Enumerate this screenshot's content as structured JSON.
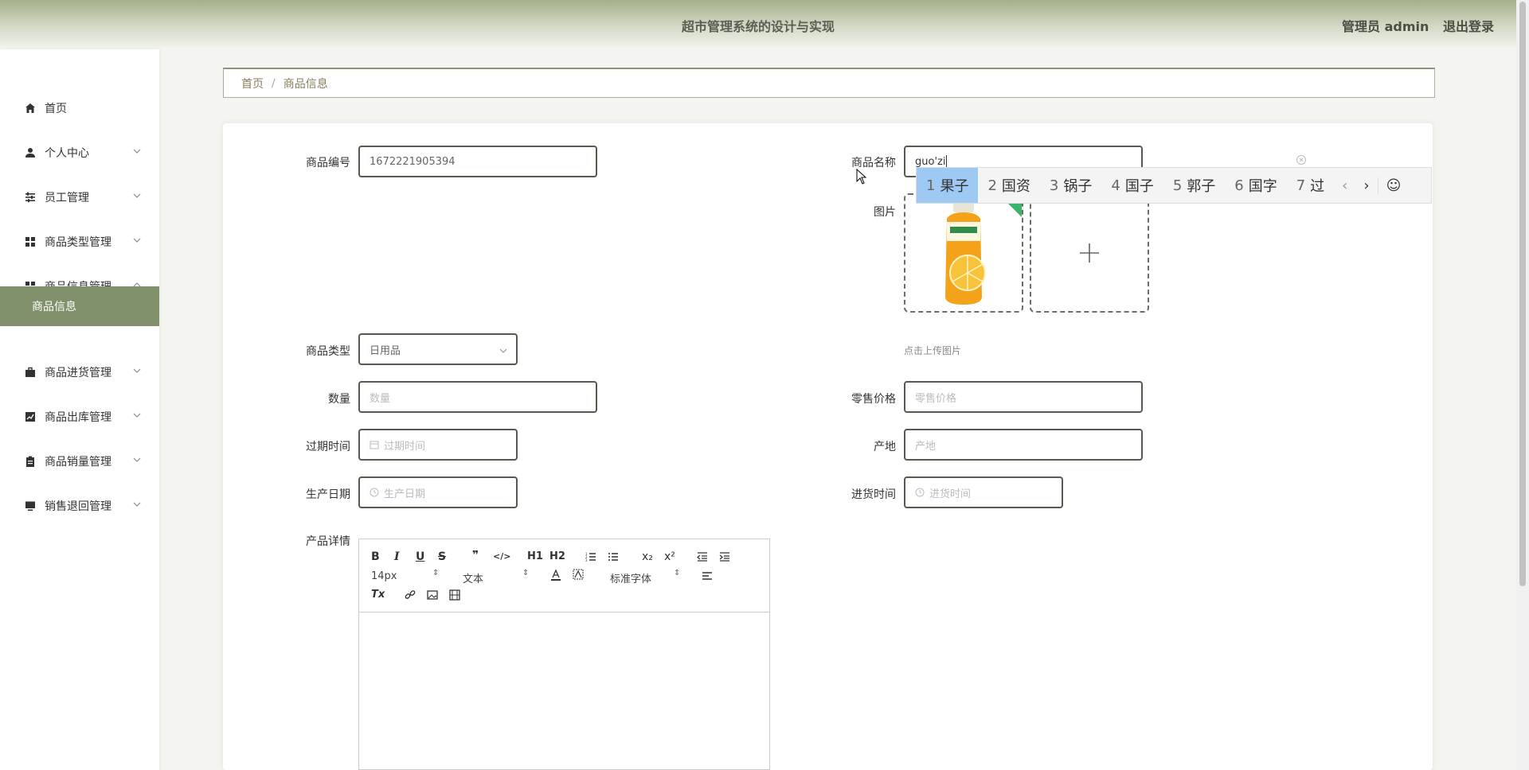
{
  "header": {
    "title": "超市管理系统的设计与实现",
    "role": "管理员 admin",
    "logout": "退出登录"
  },
  "sidebar": {
    "items": [
      {
        "label": "首页",
        "icon": "home-icon"
      },
      {
        "label": "个人中心",
        "icon": "user-icon"
      },
      {
        "label": "员工管理",
        "icon": "sliders-icon"
      },
      {
        "label": "商品类型管理",
        "icon": "grid-icon"
      },
      {
        "label": "商品信息管理",
        "icon": "grid-icon"
      },
      {
        "label": "商品进货管理",
        "icon": "briefcase-icon"
      },
      {
        "label": "商品出库管理",
        "icon": "chart-icon"
      },
      {
        "label": "商品销量管理",
        "icon": "clipboard-icon"
      },
      {
        "label": "销售退回管理",
        "icon": "monitor-icon"
      }
    ],
    "active_sub": "商品信息"
  },
  "breadcrumb": {
    "home": "首页",
    "sep": "/",
    "current": "商品信息"
  },
  "form": {
    "code_label": "商品编号",
    "code_value": "1672221905394",
    "name_label": "商品名称",
    "name_value": "guo'zi",
    "image_label": "图片",
    "upload_hint": "点击上传图片",
    "type_label": "商品类型",
    "type_value": "日用品",
    "qty_label": "数量",
    "qty_placeholder": "数量",
    "price_label": "零售价格",
    "price_placeholder": "零售价格",
    "expire_label": "过期时间",
    "expire_placeholder": "过期时间",
    "origin_label": "产地",
    "origin_placeholder": "产地",
    "produce_label": "生产日期",
    "produce_placeholder": "生产日期",
    "stock_label": "进货时间",
    "stock_placeholder": "进货时间",
    "detail_label": "产品详情"
  },
  "ime": {
    "candidates": [
      {
        "n": "1",
        "w": "果子"
      },
      {
        "n": "2",
        "w": "国资"
      },
      {
        "n": "3",
        "w": "锅子"
      },
      {
        "n": "4",
        "w": "国子"
      },
      {
        "n": "5",
        "w": "郭子"
      },
      {
        "n": "6",
        "w": "国字"
      },
      {
        "n": "7",
        "w": "过"
      }
    ],
    "prev": "‹",
    "next": "›",
    "emoji": "☺"
  },
  "editor": {
    "font_size": "14px",
    "format": "文本",
    "font_family": "标准字体",
    "bold": "B",
    "italic": "I",
    "underline": "U",
    "strike": "S",
    "quote": "❞",
    "code": "</>",
    "h1": "H1",
    "h2": "H2",
    "sub": "x₂",
    "sup": "x²",
    "clean": "Tx"
  },
  "colors": {
    "accent": "#7f906a",
    "header_top": "#a4b08a"
  }
}
